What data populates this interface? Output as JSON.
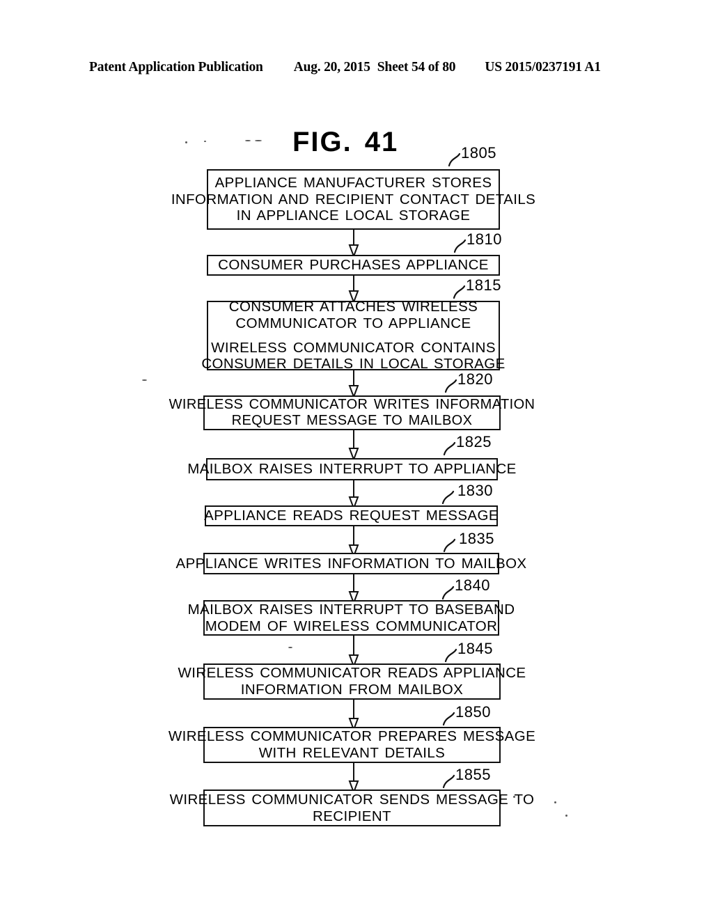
{
  "header": {
    "publication": "Patent Application Publication",
    "date": "Aug. 20, 2015",
    "sheet": "Sheet 54 of 80",
    "docnum": "US 2015/0237191 A1"
  },
  "figure": {
    "label": "FIG.",
    "number": "41"
  },
  "flowchart": {
    "type": "flowchart",
    "orientation": "top-to-bottom",
    "connector": "single-arrow-down",
    "steps": [
      {
        "ref": "1805",
        "lines": [
          "APPLIANCE MANUFACTURER STORES",
          "INFORMATION AND RECIPIENT CONTACT DETAILS",
          "IN APPLIANCE LOCAL STORAGE"
        ]
      },
      {
        "ref": "1810",
        "lines": [
          "CONSUMER PURCHASES APPLIANCE"
        ]
      },
      {
        "ref": "1815",
        "lines": [
          "CONSUMER ATTACHES WIRELESS",
          "COMMUNICATOR TO APPLIANCE",
          "WIRELESS COMMUNICATOR CONTAINS",
          "CONSUMER DETAILS IN LOCAL STORAGE"
        ],
        "gap_before_line": 3
      },
      {
        "ref": "1820",
        "lines": [
          "WIRELESS COMMUNICATOR WRITES INFORMATION",
          "REQUEST MESSAGE TO MAILBOX"
        ]
      },
      {
        "ref": "1825",
        "lines": [
          "MAILBOX RAISES INTERRUPT TO APPLIANCE"
        ]
      },
      {
        "ref": "1830",
        "lines": [
          "APPLIANCE READS REQUEST MESSAGE"
        ]
      },
      {
        "ref": "1835",
        "lines": [
          "APPLIANCE WRITES INFORMATION TO MAILBOX"
        ]
      },
      {
        "ref": "1840",
        "lines": [
          "MAILBOX RAISES INTERRUPT TO BASEBAND",
          "MODEM OF WIRELESS COMMUNICATOR"
        ]
      },
      {
        "ref": "1845",
        "lines": [
          "WIRELESS COMMUNICATOR READS APPLIANCE",
          "INFORMATION FROM MAILBOX"
        ]
      },
      {
        "ref": "1850",
        "lines": [
          "WIRELESS COMMUNICATOR PREPARES MESSAGE",
          "WITH RELEVANT DETAILS"
        ]
      },
      {
        "ref": "1855",
        "lines": [
          "WIRELESS COMMUNICATOR SENDS MESSAGE TO",
          "RECIPIENT"
        ]
      }
    ]
  },
  "colors": {
    "ink": "#111111",
    "paper": "#ffffff"
  }
}
